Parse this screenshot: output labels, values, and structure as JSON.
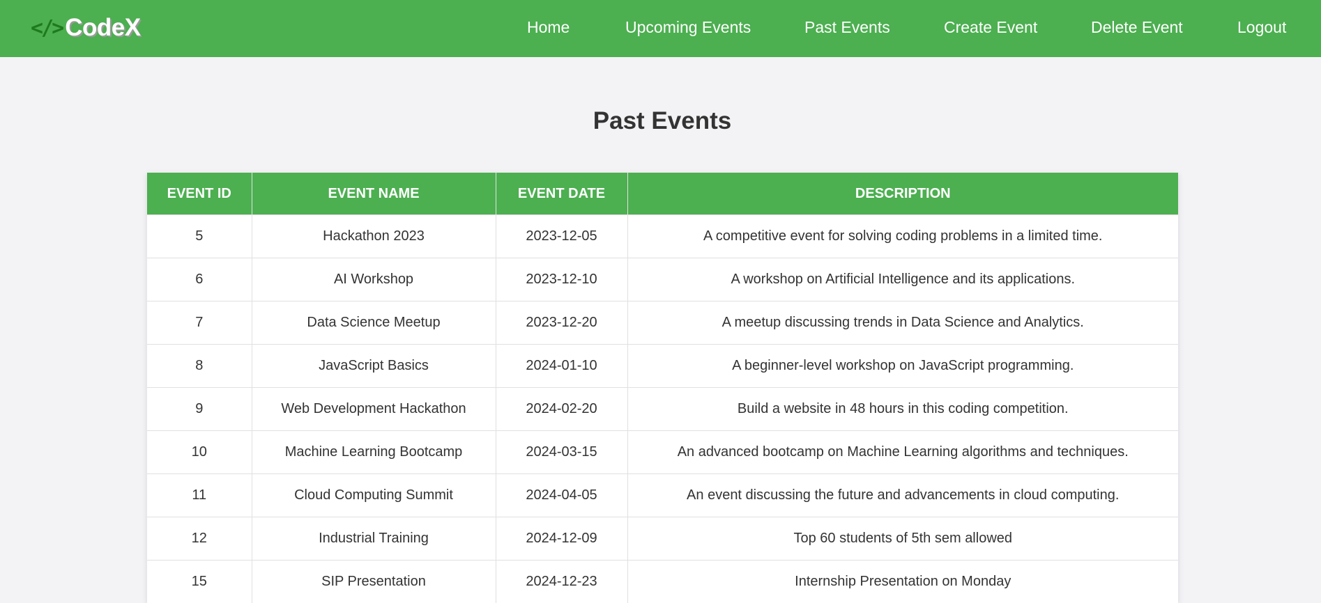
{
  "header": {
    "logo": {
      "icon": "code-brackets-icon",
      "icon_glyph": "</>",
      "text": "CodeX"
    },
    "nav": {
      "home": "Home",
      "upcoming": "Upcoming Events",
      "past": "Past Events",
      "create": "Create Event",
      "delete": "Delete Event",
      "logout": "Logout"
    },
    "accent_color": "#4caf50"
  },
  "main": {
    "title": "Past Events",
    "table": {
      "columns": [
        "EVENT ID",
        "EVENT NAME",
        "EVENT DATE",
        "DESCRIPTION"
      ],
      "rows": [
        {
          "id": "5",
          "name": "Hackathon 2023",
          "date": "2023-12-05",
          "description": "A competitive event for solving coding problems in a limited time."
        },
        {
          "id": "6",
          "name": "AI Workshop",
          "date": "2023-12-10",
          "description": "A workshop on Artificial Intelligence and its applications."
        },
        {
          "id": "7",
          "name": "Data Science Meetup",
          "date": "2023-12-20",
          "description": "A meetup discussing trends in Data Science and Analytics."
        },
        {
          "id": "8",
          "name": "JavaScript Basics",
          "date": "2024-01-10",
          "description": "A beginner-level workshop on JavaScript programming."
        },
        {
          "id": "9",
          "name": "Web Development Hackathon",
          "date": "2024-02-20",
          "description": "Build a website in 48 hours in this coding competition."
        },
        {
          "id": "10",
          "name": "Machine Learning Bootcamp",
          "date": "2024-03-15",
          "description": "An advanced bootcamp on Machine Learning algorithms and techniques."
        },
        {
          "id": "11",
          "name": "Cloud Computing Summit",
          "date": "2024-04-05",
          "description": "An event discussing the future and advancements in cloud computing."
        },
        {
          "id": "12",
          "name": "Industrial Training",
          "date": "2024-12-09",
          "description": "Top 60 students of 5th sem allowed"
        },
        {
          "id": "15",
          "name": "SIP Presentation",
          "date": "2024-12-23",
          "description": "Internship Presentation on Monday"
        }
      ]
    }
  }
}
